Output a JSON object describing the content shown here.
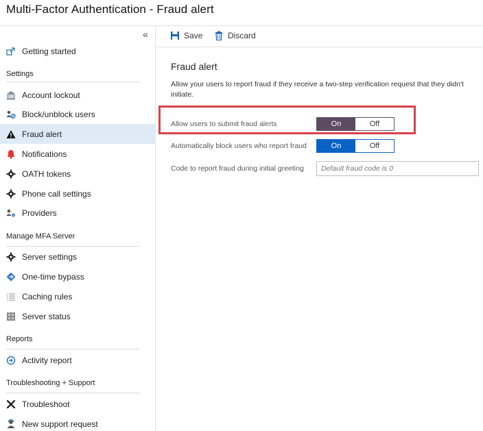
{
  "header": {
    "title": "Multi-Factor Authentication - Fraud alert"
  },
  "sidebar": {
    "collapse": "«",
    "getting_started": "Getting started",
    "sections": [
      {
        "heading": "Settings",
        "items": [
          "Account lockout",
          "Block/unblock users",
          "Fraud alert",
          "Notifications",
          "OATH tokens",
          "Phone call settings",
          "Providers"
        ]
      },
      {
        "heading": "Manage MFA Server",
        "items": [
          "Server settings",
          "One-time bypass",
          "Caching rules",
          "Server status"
        ]
      },
      {
        "heading": "Reports",
        "items": [
          "Activity report"
        ]
      },
      {
        "heading": "Troubleshooting + Support",
        "items": [
          "Troubleshoot",
          "New support request"
        ]
      }
    ],
    "active_item": "Fraud alert"
  },
  "toolbar": {
    "save_label": "Save",
    "discard_label": "Discard"
  },
  "main": {
    "title": "Fraud alert",
    "description": "Allow your users to report fraud if they receive a two-step verification request that they didn't initiate.",
    "settings": [
      {
        "label": "Allow users to submit fraud alerts",
        "on_label": "On",
        "off_label": "Off",
        "value": "On"
      },
      {
        "label": "Automatically block users who report fraud",
        "on_label": "On",
        "off_label": "Off",
        "value": "On"
      },
      {
        "label": "Code to report fraud during initial greeting",
        "placeholder": "Default fraud code is 0"
      }
    ]
  },
  "colors": {
    "toggle_purple": "#5d4b62",
    "toggle_blue": "#0a62c4",
    "highlight_border": "#d9414a",
    "active_nav_bg": "#deebf7"
  }
}
